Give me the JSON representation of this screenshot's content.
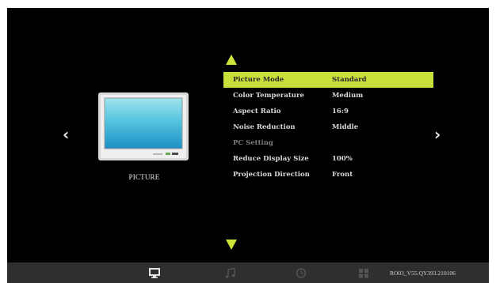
{
  "side_panel": {
    "label": "PICTURE",
    "icon": "tv-monitor-icon"
  },
  "navigation": {
    "left_glyph": "‹",
    "right_glyph": "›"
  },
  "menu": {
    "items": [
      {
        "label": "Picture Mode",
        "value": "Standard",
        "state": "selected"
      },
      {
        "label": "Color Temperature",
        "value": "Medium",
        "state": "normal"
      },
      {
        "label": "Aspect Ratio",
        "value": "16:9",
        "state": "normal"
      },
      {
        "label": "Noise Reduction",
        "value": "Middle",
        "state": "normal"
      },
      {
        "label": "PC Setting",
        "value": "",
        "state": "disabled"
      },
      {
        "label": "Reduce Display Size",
        "value": "100%",
        "state": "normal"
      },
      {
        "label": "Projection Direction",
        "value": "Front",
        "state": "normal"
      }
    ]
  },
  "bottom_bar": {
    "icons": [
      "monitor-icon",
      "music-note-icon",
      "clock-icon",
      "apps-grid-icon"
    ],
    "version": "RO03_V55.QY393.210106"
  },
  "colors": {
    "highlight": "#c8df3c",
    "background": "#000000",
    "bar": "#2f2f2f"
  }
}
